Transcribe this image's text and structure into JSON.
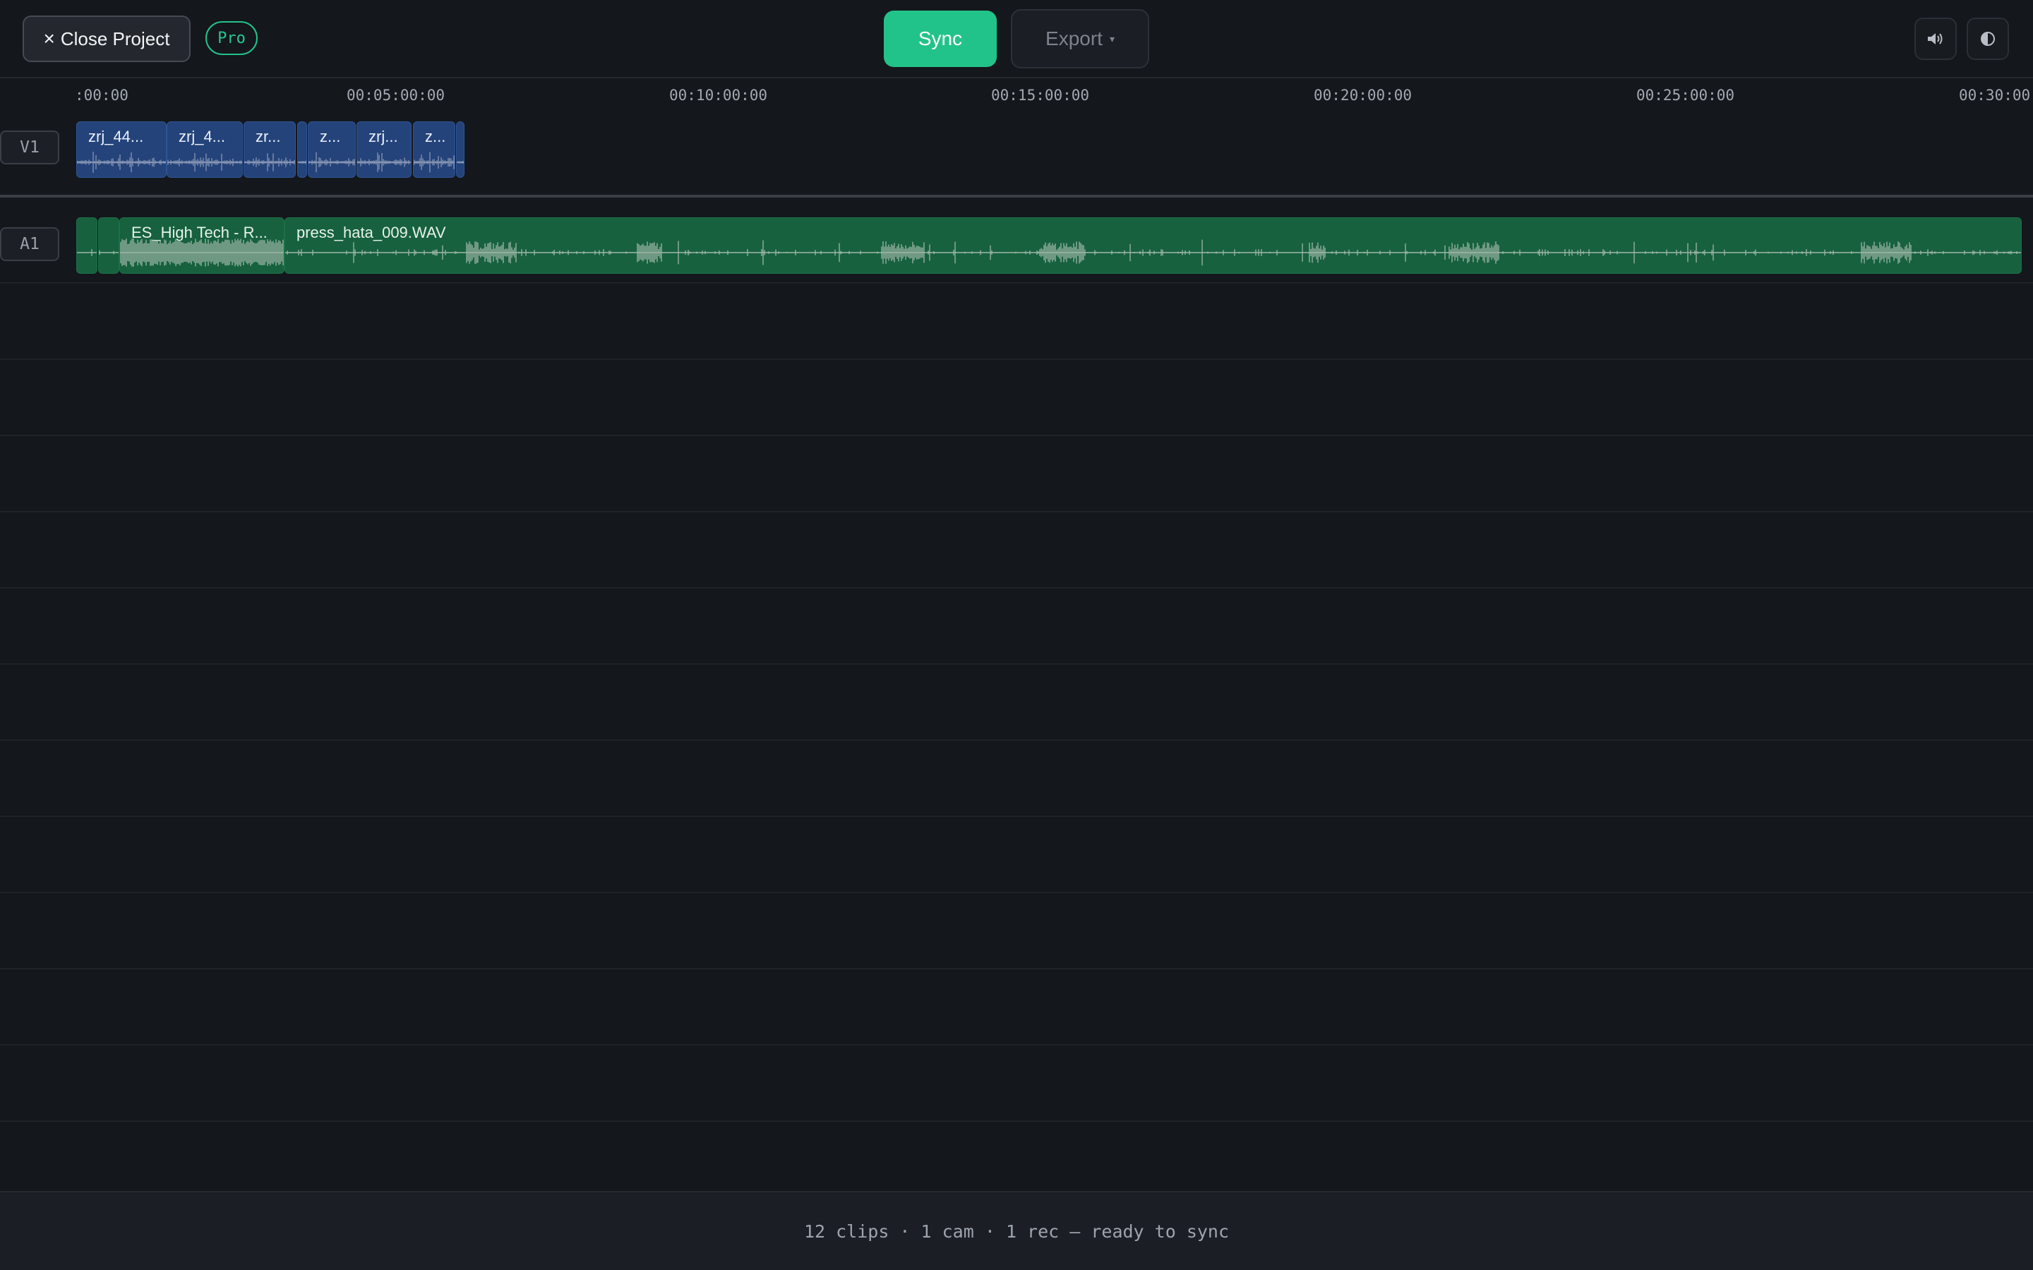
{
  "toolbar": {
    "close_label": "Close Project",
    "close_icon": "×",
    "badge": "Pro",
    "sync_label": "Sync",
    "export_label": "Export",
    "export_caret": "▾",
    "speaker_icon": "🔊",
    "contrast_icon": "◐"
  },
  "ruler": {
    "ticks": [
      ":00:00",
      "00:05:00:00",
      "00:10:00:00",
      "00:15:00:00",
      "00:20:00:00",
      "00:25:00:00",
      "00:30:00"
    ]
  },
  "tracks": {
    "video": {
      "label": "V1",
      "clips": [
        "zrj_44...",
        "zrj_4...",
        "zr...",
        "",
        "z...",
        "zrj...",
        "z...",
        ""
      ]
    },
    "audio": {
      "label": "A1",
      "clips": [
        "",
        "",
        "ES_High Tech - R...",
        "press_hata_009.WAV"
      ]
    }
  },
  "status": {
    "text": "12 clips · 1 cam · 1 rec — ready to sync"
  },
  "colors": {
    "accent": "#22c38a",
    "video_clip": "#24437a",
    "audio_clip": "#17613e",
    "background": "#14171c"
  }
}
